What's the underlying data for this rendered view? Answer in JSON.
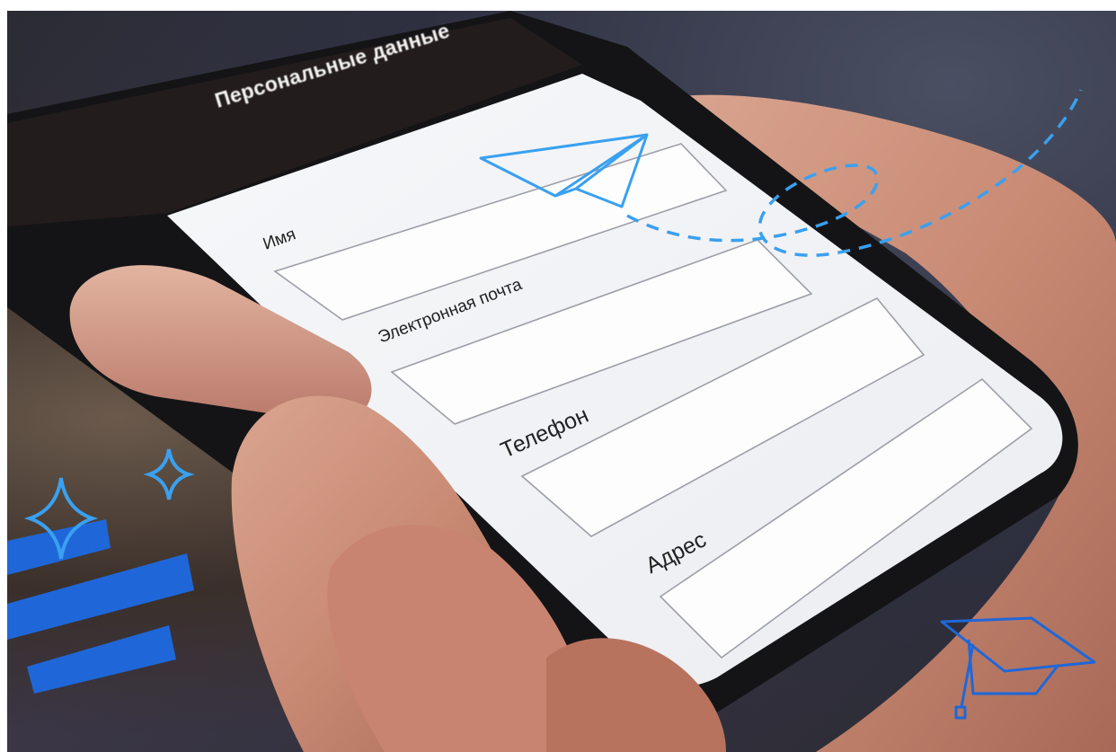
{
  "screen": {
    "title": "Персональные данные",
    "fields": [
      {
        "label": "Имя",
        "value": ""
      },
      {
        "label": "Электронная почта",
        "value": ""
      },
      {
        "label": "Телефон",
        "value": ""
      },
      {
        "label": "Адрес",
        "value": ""
      }
    ]
  },
  "decorations": {
    "accent_color": "#3aa0f0",
    "stripe_color": "#1f67d8",
    "icons": [
      "paper-plane-icon",
      "graduation-cap-icon",
      "sparkle-icon"
    ]
  }
}
